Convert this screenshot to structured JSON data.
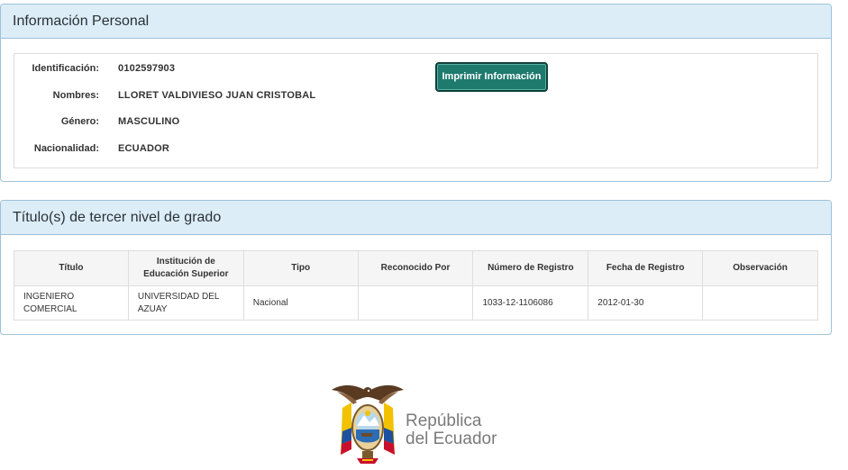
{
  "personal": {
    "heading": "Información Personal",
    "fields": [
      {
        "label": "Identificación:",
        "value": "0102597903"
      },
      {
        "label": "Nombres:",
        "value": "LLORET VALDIVIESO JUAN CRISTOBAL"
      },
      {
        "label": "Género:",
        "value": "MASCULINO"
      },
      {
        "label": "Nacionalidad:",
        "value": "ECUADOR"
      }
    ],
    "print_button": "Imprimir Información"
  },
  "titles": {
    "heading": "Título(s) de tercer nivel de grado",
    "columns": [
      "Título",
      "Institución de Educación Superior",
      "Tipo",
      "Reconocido Por",
      "Número de Registro",
      "Fecha de Registro",
      "Observación"
    ],
    "rows": [
      [
        "INGENIERO COMERCIAL",
        "UNIVERSIDAD DEL AZUAY",
        "Nacional",
        "",
        "1033-12-1106086",
        "2012-01-30",
        ""
      ]
    ]
  },
  "footer": {
    "logo_icon": "ecuador-coat-of-arms-icon",
    "logo_line1": "República",
    "logo_line2": "del Ecuador"
  }
}
